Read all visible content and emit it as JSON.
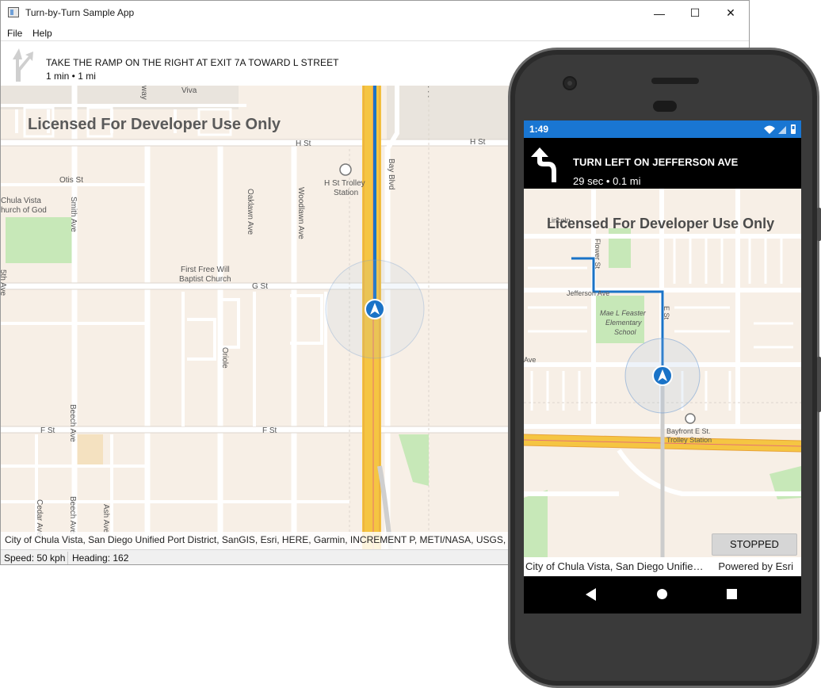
{
  "window": {
    "title": "Turn-by-Turn Sample App",
    "controls": {
      "minimize": "—",
      "maximize": "☐",
      "close": "✕"
    }
  },
  "menu": {
    "items": [
      "File",
      "Help"
    ]
  },
  "banner": {
    "instruction": "TAKE THE RAMP ON THE RIGHT AT EXIT 7A TOWARD L STREET",
    "detail": "1 min • 1 mi",
    "icon": "ramp-right-icon"
  },
  "desktop_map": {
    "watermark": "Licensed For Developer Use Only",
    "labels": {
      "viva": "Viva",
      "hst_w": "H St",
      "hst_e": "H St",
      "otis": "Otis St",
      "chula1": "Chula Vista",
      "chula2": "hurch of God",
      "smith": "Smith Ave",
      "oaklawn": "Oaklawn Ave",
      "woodlawn": "Woodlawn Ave",
      "trolley1": "H St Trolley",
      "trolley2": "Station",
      "bay": "Bay Blvd",
      "firstfree1": "First Free Will",
      "firstfree2": "Baptist Church",
      "gst": "G St",
      "oriole": "Oriole",
      "beech": "Beech Ave",
      "fst_w": "F St",
      "fst_e": "F St",
      "cedar": "Cedar Ave",
      "beech2": "Beech Ave",
      "ash": "Ash Ave",
      "fifth": "5th Ave",
      "way": "way"
    },
    "attribution": "City of Chula Vista, San Diego Unified Port District, SanGIS, Esri, HERE, Garmin, INCREMENT P, METI/NASA, USGS, Bureau"
  },
  "status": {
    "speed": "Speed: 50 kph",
    "heading": "Heading: 162"
  },
  "phone": {
    "time": "1:49",
    "status_icons": "wifi-icon signal-icon battery-icon",
    "instruction": "TURN LEFT ON JEFFERSON AVE",
    "detail": "29 sec • 0.1 mi",
    "icon": "turn-left-icon",
    "watermark": "Licensed For Developer Use Only",
    "labels": {
      "jefferson": "Jefferson Ave",
      "flower": "Flower St",
      "feaster1": "Mae L Feaster",
      "feaster2": "Elementary",
      "feaster3": "School",
      "bayfront1": "Bayfront E St.",
      "bayfront2": "Trolley Station",
      "ave": "Ave",
      "est": "E St",
      "lincoln": "Lincoln"
    },
    "stop_button": "STOPPED",
    "attribution": "City of Chula Vista, San Diego Unified Port District",
    "powered_by": "Powered by Esri"
  },
  "colors": {
    "accent": "#1976d2",
    "route": "#1a73c7",
    "freeway": "#f5c542",
    "map_bg": "#f7efe6",
    "park": "#c7e8b8"
  }
}
